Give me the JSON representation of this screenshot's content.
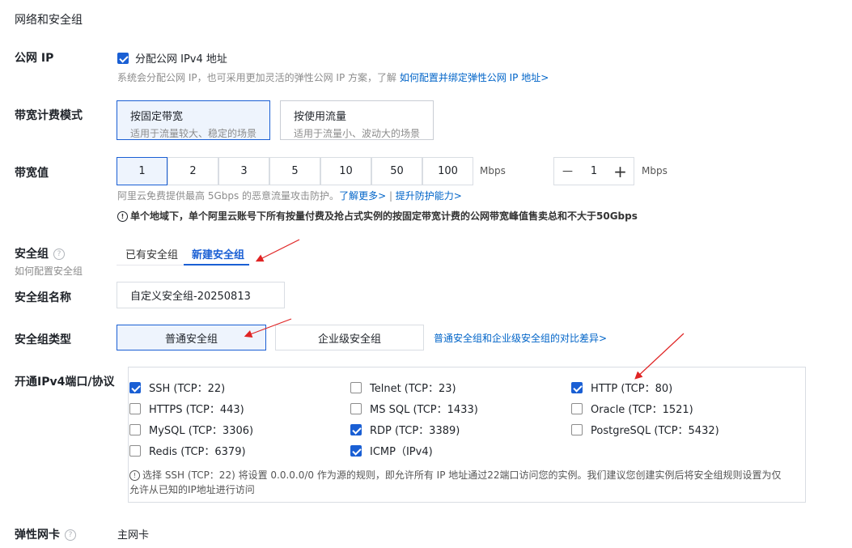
{
  "section_title": "网络和安全组",
  "public_ip": {
    "label": "公网 IP",
    "checkbox_label": "分配公网 IPv4 地址",
    "checked": true,
    "hint": "系统会分配公网 IP，也可采用更加灵活的弹性公网 IP 方案，了解",
    "hint_link": "如何配置并绑定弹性公网 IP 地址>"
  },
  "billing_mode": {
    "label": "带宽计费模式",
    "options": [
      {
        "title": "按固定带宽",
        "desc": "适用于流量较大、稳定的场景",
        "selected": true
      },
      {
        "title": "按使用流量",
        "desc": "适用于流量小、波动大的场景",
        "selected": false
      }
    ]
  },
  "bandwidth": {
    "label": "带宽值",
    "options": [
      "1",
      "2",
      "3",
      "5",
      "10",
      "50",
      "100"
    ],
    "selected": "1",
    "unit": "Mbps",
    "stepper_value": "1",
    "stepper_minus": "—",
    "stepper_plus": "+",
    "hint": "阿里云免费提供最高 5Gbps 的恶意流量攻击防护。",
    "hint_link1": "了解更多>",
    "hint_sep": " | ",
    "hint_link2": "提升防护能力>",
    "notice_icon": "!",
    "notice": "单个地域下，单个阿里云账号下所有按量付费及抢占式实例的按固定带宽计费的公网带宽峰值售卖总和不大于50Gbps"
  },
  "security_group": {
    "label": "安全组",
    "help_icon": "?",
    "sublabel": "如何配置安全组",
    "tabs": [
      {
        "label": "已有安全组",
        "active": false
      },
      {
        "label": "新建安全组",
        "active": true
      }
    ]
  },
  "sg_name": {
    "label": "安全组名称",
    "value": "自定义安全组-20250813"
  },
  "sg_type": {
    "label": "安全组类型",
    "options": [
      {
        "label": "普通安全组",
        "selected": true
      },
      {
        "label": "企业级安全组",
        "selected": false
      }
    ],
    "link": "普通安全组和企业级安全组的对比差异>"
  },
  "ports": {
    "label": "开通IPv4端口/协议",
    "items": [
      {
        "label": "SSH (TCP：22)",
        "checked": true
      },
      {
        "label": "Telnet (TCP：23)",
        "checked": false
      },
      {
        "label": "HTTP (TCP：80)",
        "checked": true
      },
      {
        "label": "HTTPS (TCP：443)",
        "checked": false
      },
      {
        "label": "MS SQL (TCP：1433)",
        "checked": false
      },
      {
        "label": "Oracle (TCP：1521)",
        "checked": false
      },
      {
        "label": "MySQL (TCP：3306)",
        "checked": false
      },
      {
        "label": "RDP (TCP：3389)",
        "checked": true
      },
      {
        "label": "PostgreSQL (TCP：5432)",
        "checked": false
      },
      {
        "label": "Redis (TCP：6379)",
        "checked": false
      },
      {
        "label": "ICMP（IPv4)",
        "checked": true
      }
    ],
    "warning_icon": "!",
    "warning_line1": "选择 SSH (TCP：22) 将设置 0.0.0.0/0 作为源的规则，即允许所有 IP 地址通过22端口访问您的实例。我们建议您创建实例后将安全组规则设置为仅",
    "warning_line2": "允许从已知的IP地址进行访问"
  },
  "eni": {
    "label": "弹性网卡",
    "help_icon": "?",
    "value": "主网卡"
  },
  "colors": {
    "accent": "#1a5fd4",
    "link": "#0064c8",
    "annotation_arrow": "#e02424"
  }
}
